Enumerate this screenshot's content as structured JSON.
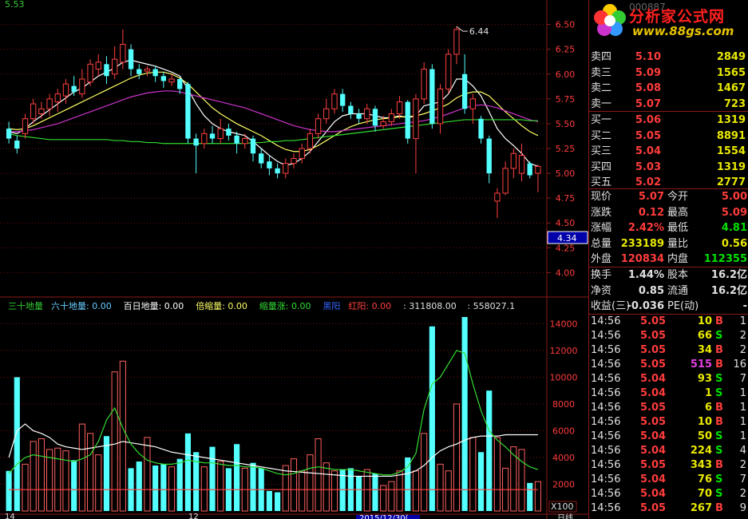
{
  "chart_data": {
    "type": "candlestick",
    "price_axis": {
      "ticks": [
        "6.50",
        "6.25",
        "6.00",
        "5.75",
        "5.50",
        "5.25",
        "5.00",
        "4.75",
        "4.50",
        "4.25",
        "4.00"
      ],
      "min": 3.85,
      "max": 6.65
    },
    "current_price_marker": "4.34",
    "top_left_readout": "5.53",
    "high_annotation": "6.44",
    "candles": [
      [
        5.45,
        5.35,
        5.52,
        5.3
      ],
      [
        5.33,
        5.25,
        5.38,
        5.2
      ],
      [
        5.4,
        5.55,
        5.6,
        5.35
      ],
      [
        5.55,
        5.7,
        5.75,
        5.5
      ],
      [
        5.6,
        5.65,
        5.72,
        5.55
      ],
      [
        5.65,
        5.75,
        5.8,
        5.58
      ],
      [
        5.72,
        5.8,
        5.85,
        5.62
      ],
      [
        5.78,
        5.9,
        5.95,
        5.7
      ],
      [
        5.88,
        5.82,
        5.98,
        5.78
      ],
      [
        5.8,
        5.95,
        6.05,
        5.76
      ],
      [
        5.92,
        6.1,
        6.15,
        5.88
      ],
      [
        6.05,
        6.12,
        6.2,
        5.98
      ],
      [
        6.1,
        5.98,
        6.18,
        5.9
      ],
      [
        6.0,
        6.15,
        6.28,
        5.95
      ],
      [
        6.12,
        6.3,
        6.45,
        6.05
      ],
      [
        6.25,
        6.05,
        6.3,
        5.98
      ],
      [
        6.05,
        6.0,
        6.1,
        5.95
      ],
      [
        6.03,
        6.05,
        6.08,
        5.98
      ],
      [
        6.05,
        5.98,
        6.08,
        5.92
      ],
      [
        5.98,
        5.93,
        6.02,
        5.86
      ],
      [
        5.92,
        5.95,
        6.0,
        5.88
      ],
      [
        5.95,
        5.85,
        5.96,
        5.8
      ],
      [
        5.9,
        5.35,
        5.92,
        5.3
      ],
      [
        5.35,
        5.28,
        5.4,
        5.0
      ],
      [
        5.3,
        5.4,
        5.45,
        5.25
      ],
      [
        5.4,
        5.35,
        5.48,
        5.3
      ],
      [
        5.35,
        5.45,
        5.55,
        5.3
      ],
      [
        5.45,
        5.38,
        5.5,
        5.33
      ],
      [
        5.38,
        5.3,
        5.42,
        5.2
      ],
      [
        5.3,
        5.35,
        5.4,
        5.25
      ],
      [
        5.35,
        5.2,
        5.38,
        5.12
      ],
      [
        5.2,
        5.1,
        5.25,
        5.05
      ],
      [
        5.12,
        5.05,
        5.18,
        4.98
      ],
      [
        5.05,
        5.0,
        5.1,
        4.95
      ],
      [
        5.0,
        5.1,
        5.15,
        4.95
      ],
      [
        5.1,
        5.15,
        5.2,
        5.05
      ],
      [
        5.15,
        5.25,
        5.3,
        5.1
      ],
      [
        5.25,
        5.4,
        5.45,
        5.2
      ],
      [
        5.4,
        5.55,
        5.6,
        5.35
      ],
      [
        5.55,
        5.65,
        5.75,
        5.5
      ],
      [
        5.65,
        5.8,
        5.85,
        5.6
      ],
      [
        5.8,
        5.68,
        5.85,
        5.62
      ],
      [
        5.68,
        5.6,
        5.72,
        5.55
      ],
      [
        5.6,
        5.55,
        5.65,
        5.5
      ],
      [
        5.55,
        5.65,
        5.7,
        5.5
      ],
      [
        5.65,
        5.48,
        5.68,
        5.42
      ],
      [
        5.48,
        5.52,
        5.58,
        5.45
      ],
      [
        5.52,
        5.6,
        5.65,
        5.48
      ],
      [
        5.6,
        5.72,
        5.78,
        5.55
      ],
      [
        5.72,
        5.35,
        5.74,
        5.3
      ],
      [
        5.35,
        5.75,
        5.8,
        5.0
      ],
      [
        5.75,
        6.05,
        6.12,
        5.7
      ],
      [
        6.05,
        5.5,
        6.1,
        5.45
      ],
      [
        5.5,
        5.85,
        5.9,
        5.4
      ],
      [
        5.85,
        6.2,
        6.25,
        5.8
      ],
      [
        6.2,
        6.45,
        6.48,
        6.1
      ],
      [
        6.0,
        5.65,
        6.2,
        5.6
      ],
      [
        5.65,
        5.75,
        5.8,
        5.5
      ],
      [
        5.55,
        5.35,
        5.58,
        5.3
      ],
      [
        5.35,
        5.0,
        5.38,
        4.9
      ],
      [
        4.72,
        4.8,
        4.85,
        4.55
      ],
      [
        4.8,
        5.05,
        5.12,
        4.78
      ],
      [
        5.05,
        5.2,
        5.25,
        4.95
      ],
      [
        5.0,
        5.18,
        5.3,
        4.92
      ],
      [
        5.1,
        4.98,
        5.12,
        4.95
      ],
      [
        5.0,
        5.07,
        5.09,
        4.81
      ]
    ],
    "ma_lines": [
      {
        "color": "#ffffff",
        "values": [
          5.42,
          5.4,
          5.45,
          5.52,
          5.58,
          5.64,
          5.7,
          5.76,
          5.82,
          5.86,
          5.92,
          5.98,
          6.02,
          6.06,
          6.12,
          6.14,
          6.12,
          6.1,
          6.08,
          6.05,
          6.02,
          5.98,
          5.85,
          5.7,
          5.58,
          5.5,
          5.45,
          5.42,
          5.4,
          5.38,
          5.32,
          5.25,
          5.18,
          5.12,
          5.08,
          5.1,
          5.15,
          5.22,
          5.32,
          5.42,
          5.52,
          5.58,
          5.6,
          5.6,
          5.6,
          5.58,
          5.56,
          5.56,
          5.58,
          5.56,
          5.58,
          5.68,
          5.7,
          5.72,
          5.8,
          5.95,
          5.95,
          5.88,
          5.78,
          5.62,
          5.45,
          5.35,
          5.28,
          5.2,
          5.1,
          5.07
        ]
      },
      {
        "color": "#ffff66",
        "values": [
          5.45,
          5.44,
          5.45,
          5.48,
          5.52,
          5.56,
          5.6,
          5.64,
          5.68,
          5.72,
          5.76,
          5.8,
          5.84,
          5.88,
          5.92,
          5.96,
          5.99,
          6.01,
          6.02,
          6.02,
          6.0,
          5.96,
          5.9,
          5.82,
          5.74,
          5.66,
          5.6,
          5.55,
          5.5,
          5.46,
          5.42,
          5.38,
          5.33,
          5.28,
          5.24,
          5.22,
          5.22,
          5.24,
          5.28,
          5.33,
          5.38,
          5.43,
          5.47,
          5.5,
          5.52,
          5.54,
          5.55,
          5.56,
          5.57,
          5.57,
          5.58,
          5.6,
          5.63,
          5.66,
          5.7,
          5.76,
          5.8,
          5.82,
          5.82,
          5.78,
          5.7,
          5.62,
          5.55,
          5.48,
          5.42,
          5.38
        ]
      },
      {
        "color": "#cc33cc",
        "values": [
          5.42,
          5.42,
          5.43,
          5.44,
          5.46,
          5.48,
          5.5,
          5.53,
          5.56,
          5.59,
          5.62,
          5.65,
          5.68,
          5.71,
          5.74,
          5.77,
          5.79,
          5.81,
          5.82,
          5.83,
          5.83,
          5.82,
          5.8,
          5.78,
          5.76,
          5.74,
          5.72,
          5.7,
          5.68,
          5.66,
          5.63,
          5.6,
          5.57,
          5.54,
          5.51,
          5.48,
          5.46,
          5.44,
          5.43,
          5.42,
          5.42,
          5.43,
          5.44,
          5.45,
          5.46,
          5.47,
          5.48,
          5.49,
          5.5,
          5.51,
          5.52,
          5.53,
          5.55,
          5.57,
          5.6,
          5.63,
          5.66,
          5.68,
          5.69,
          5.68,
          5.66,
          5.63,
          5.6,
          5.57,
          5.54,
          5.52
        ]
      },
      {
        "color": "#33dd33",
        "values": [
          5.4,
          5.38,
          5.37,
          5.36,
          5.35,
          5.34,
          5.34,
          5.34,
          5.34,
          5.34,
          5.34,
          5.34,
          5.34,
          5.33,
          5.33,
          5.32,
          5.32,
          5.31,
          5.31,
          5.3,
          5.3,
          5.3,
          5.3,
          5.3,
          5.3,
          5.3,
          5.3,
          5.3,
          5.3,
          5.3,
          5.31,
          5.31,
          5.32,
          5.32,
          5.33,
          5.33,
          5.34,
          5.35,
          5.36,
          5.37,
          5.38,
          5.39,
          5.4,
          5.41,
          5.42,
          5.43,
          5.44,
          5.45,
          5.46,
          5.47,
          5.48,
          5.49,
          5.5,
          5.51,
          5.52,
          5.53,
          5.54,
          5.54,
          5.54,
          5.54,
          5.54,
          5.54,
          5.54,
          5.54,
          5.53,
          5.53
        ]
      }
    ],
    "indicator_legend": [
      {
        "label": "三十地量",
        "value": "",
        "color": "#33cc33"
      },
      {
        "label": "六十地量:",
        "value": "0.00",
        "color": "#66ccff"
      },
      {
        "label": "百日地量:",
        "value": "0.00",
        "color": "#ffffff"
      },
      {
        "label": "倍缩量:",
        "value": "0.00",
        "color": "#ffff66"
      },
      {
        "label": "缩量涨:",
        "value": "0.00",
        "color": "#33dd33"
      },
      {
        "label": "黑阳",
        "value": "",
        "color": "#3366ff"
      },
      {
        "label": "红阳:",
        "value": "0.00",
        "color": "#ff4040"
      },
      {
        "label": "",
        "value": ": 311808.00",
        "color": "#e0e0e0"
      },
      {
        "label": "",
        "value": ": 558027.1",
        "color": "#e0e0e0"
      }
    ],
    "volume_axis": {
      "ticks": [
        "14000",
        "12000",
        "10000",
        "8000",
        "6000",
        "4000",
        "2000"
      ],
      "min": 0,
      "max": 14800,
      "unit": "X100"
    },
    "volumes": [
      3000,
      10000,
      3500,
      5200,
      5400,
      4600,
      4700,
      4500,
      3800,
      6500,
      5800,
      4200,
      5600,
      10400,
      11200,
      3200,
      3700,
      5500,
      3400,
      3500,
      3300,
      3900,
      5800,
      4400,
      3300,
      4800,
      3700,
      3200,
      5000,
      3200,
      3600,
      3200,
      1500,
      1400,
      3400,
      3900,
      3000,
      4200,
      5400,
      3600,
      3000,
      3100,
      3200,
      2600,
      3100,
      2800,
      1900,
      2200,
      3000,
      4000,
      3000,
      5800,
      13800,
      3500,
      3000,
      8000,
      14500,
      5500,
      4400,
      9000,
      5500,
      3200,
      4800,
      4600,
      2100,
      2200
    ],
    "volume_lines": [
      {
        "color": "#ffffff",
        "values": [
          4000,
          6000,
          6500,
          6000,
          5800,
          5500,
          5000,
          4800,
          4700,
          4600,
          4700,
          4800,
          4900,
          5000,
          5200,
          5100,
          5000,
          4900,
          4800,
          4600,
          4400,
          4300,
          4200,
          4100,
          4000,
          3900,
          3800,
          3700,
          3600,
          3500,
          3400,
          3300,
          3200,
          3100,
          3000,
          2950,
          2900,
          2850,
          2800,
          2750,
          2700,
          2650,
          2600,
          2600,
          2600,
          2600,
          2600,
          2600,
          2700,
          2800,
          3000,
          3400,
          4000,
          4500,
          4800,
          5000,
          5300,
          5500,
          5600,
          5600,
          5600,
          5700,
          5700,
          5700,
          5700,
          5700
        ]
      },
      {
        "color": "#33dd33",
        "values": [
          2800,
          3500,
          4000,
          4200,
          4100,
          4000,
          3900,
          3800,
          3700,
          3900,
          4200,
          5200,
          6800,
          7700,
          6200,
          5000,
          4300,
          3800,
          3600,
          3500,
          3500,
          3600,
          3800,
          3700,
          3600,
          3600,
          3500,
          3400,
          3400,
          3300,
          3300,
          3200,
          3000,
          2800,
          2700,
          2800,
          3000,
          3200,
          3300,
          3200,
          3100,
          3100,
          3100,
          3000,
          2900,
          2800,
          2700,
          2700,
          2900,
          3300,
          4300,
          7600,
          9500,
          10000,
          11000,
          12000,
          11800,
          9500,
          7500,
          6000,
          5300,
          4800,
          4200,
          3700,
          3300,
          3100
        ]
      },
      {
        "color": "#ff4040",
        "values": [
          1600,
          1600,
          1600,
          1600,
          1600,
          1600,
          1600,
          1600,
          1600,
          1600,
          1600,
          1600,
          1600,
          1600,
          1600,
          1600,
          1600,
          1600,
          1600,
          1600,
          1600,
          1600,
          1600,
          1600,
          1600,
          1600,
          1600,
          1600,
          1600,
          1600,
          1600,
          1600,
          1600,
          1600,
          1600,
          1600,
          1600,
          1600,
          1600,
          1600,
          1600,
          1600,
          1600,
          1600,
          1600,
          1600,
          1600,
          1600,
          1600,
          1600,
          1600,
          1600,
          1600,
          1600,
          1600,
          1600,
          1600,
          1600,
          1600,
          1600,
          1600,
          1600,
          1600,
          1600,
          1600,
          1600
        ]
      }
    ],
    "footer_axis": {
      "left": "14",
      "mid": "12",
      "date": "2015/12/30(",
      "right": "日线"
    }
  },
  "quote": {
    "header_code": "000887",
    "brand_name": "分析家公式网",
    "brand_url": "www.88gs.com",
    "asks": [
      {
        "label": "卖四",
        "price": "5.10",
        "volume": "2849"
      },
      {
        "label": "卖三",
        "price": "5.09",
        "volume": "1565"
      },
      {
        "label": "卖二",
        "price": "5.08",
        "volume": "1467"
      },
      {
        "label": "卖一",
        "price": "5.07",
        "volume": "723"
      }
    ],
    "bids": [
      {
        "label": "买一",
        "price": "5.06",
        "volume": "1319"
      },
      {
        "label": "买二",
        "price": "5.05",
        "volume": "8891"
      },
      {
        "label": "买三",
        "price": "5.04",
        "volume": "1554"
      },
      {
        "label": "买四",
        "price": "5.03",
        "volume": "1319"
      },
      {
        "label": "买五",
        "price": "5.02",
        "volume": "2777"
      }
    ],
    "stats": [
      {
        "l1": "现价",
        "v1": "5.07",
        "c1": "#ff3c3c",
        "l2": "今开",
        "v2": "5.00",
        "c2": "#ff3c3c"
      },
      {
        "l1": "涨跌",
        "v1": "0.12",
        "c1": "#ff3c3c",
        "l2": "最高",
        "v2": "5.09",
        "c2": "#ff3c3c"
      },
      {
        "l1": "涨幅",
        "v1": "2.42%",
        "c1": "#ff3c3c",
        "l2": "最低",
        "v2": "4.81",
        "c2": "#00e000"
      },
      {
        "l1": "总量",
        "v1": "233189",
        "c1": "#e8e800",
        "l2": "量比",
        "v2": "0.56",
        "c2": "#e8e800"
      },
      {
        "l1": "外盘",
        "v1": "120834",
        "c1": "#ff3c3c",
        "l2": "内盘",
        "v2": "112355",
        "c2": "#00e000"
      }
    ],
    "stats2": [
      {
        "l1": "换手",
        "v1": "1.44%",
        "c1": "#e0e0e0",
        "l2": "股本",
        "v2": "16.2亿",
        "c2": "#e0e0e0"
      },
      {
        "l1": "净资",
        "v1": "0.85",
        "c1": "#e0e0e0",
        "l2": "流通",
        "v2": "16.2亿",
        "c2": "#e0e0e0"
      },
      {
        "l1": "收益(三)",
        "v1": "-0.036",
        "c1": "#e0e0e0",
        "l2": "PE(动)",
        "v2": "-",
        "c2": "#e0e0e0"
      }
    ],
    "ticks": [
      {
        "time": "14:56",
        "price": "5.05",
        "vol": "10",
        "bs": "B",
        "cnt": "1"
      },
      {
        "time": "14:56",
        "price": "5.05",
        "vol": "66",
        "bs": "S",
        "cnt": "2"
      },
      {
        "time": "14:56",
        "price": "5.05",
        "vol": "34",
        "bs": "B",
        "cnt": "2"
      },
      {
        "time": "14:56",
        "price": "5.05",
        "vol": "515",
        "bs": "B",
        "cnt": "16"
      },
      {
        "time": "14:56",
        "price": "5.04",
        "vol": "93",
        "bs": "S",
        "cnt": "7"
      },
      {
        "time": "14:56",
        "price": "5.04",
        "vol": "1",
        "bs": "S",
        "cnt": "1"
      },
      {
        "time": "14:56",
        "price": "5.05",
        "vol": "6",
        "bs": "B",
        "cnt": "1"
      },
      {
        "time": "14:56",
        "price": "5.05",
        "vol": "10",
        "bs": "B",
        "cnt": "1"
      },
      {
        "time": "14:56",
        "price": "5.04",
        "vol": "50",
        "bs": "S",
        "cnt": "1"
      },
      {
        "time": "14:56",
        "price": "5.04",
        "vol": "224",
        "bs": "S",
        "cnt": "4"
      },
      {
        "time": "14:56",
        "price": "5.05",
        "vol": "343",
        "bs": "B",
        "cnt": "2"
      },
      {
        "time": "14:56",
        "price": "5.04",
        "vol": "76",
        "bs": "S",
        "cnt": "7"
      },
      {
        "time": "14:56",
        "price": "5.04",
        "vol": "70",
        "bs": "S",
        "cnt": "2"
      },
      {
        "time": "14:56",
        "price": "5.05",
        "vol": "267",
        "bs": "B",
        "cnt": "9"
      }
    ]
  }
}
